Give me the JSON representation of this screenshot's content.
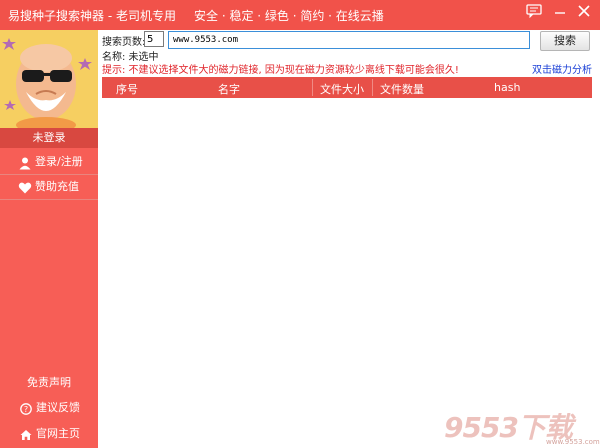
{
  "window": {
    "title": "易搜种子搜索神器 - 老司机专用",
    "slogan": "安全 · 稳定 · 绿色 · 简约 · 在线云播",
    "controls": {
      "chat": "feedback-chat-icon",
      "minimize": "—",
      "close": "✕"
    }
  },
  "sidebar": {
    "login_status": "未登录",
    "items": [
      {
        "label": "登录/注册",
        "icon": "user-icon"
      },
      {
        "label": "赞助充值",
        "icon": "heart-icon"
      }
    ],
    "disclaimer": "免责声明",
    "bottom_items": [
      {
        "label": "建议反馈",
        "icon": "help-icon"
      },
      {
        "label": "官网主页",
        "icon": "home-icon"
      }
    ]
  },
  "search": {
    "pages_label": "搜索页数:",
    "pages_value": "5",
    "url_value": "www.9553.com",
    "button_label": "搜索",
    "name_label": "名称: 未选中",
    "tip": "提示: 不建议选择文件大的磁力链接, 因为现在磁力资源较少离线下载可能会很久!",
    "analyze_link": "双击磁力分析"
  },
  "table": {
    "columns": [
      "序号",
      "名字",
      "文件大小",
      "文件数量",
      "hash"
    ],
    "rows": []
  },
  "watermark": {
    "brand": "9553下载",
    "site": "www.9553.com"
  },
  "colors": {
    "accent": "#f1524a",
    "sidebar": "#f75e56",
    "table_header": "#e85048",
    "tip_text": "#e0242a",
    "link_text": "#1a3fd6"
  }
}
